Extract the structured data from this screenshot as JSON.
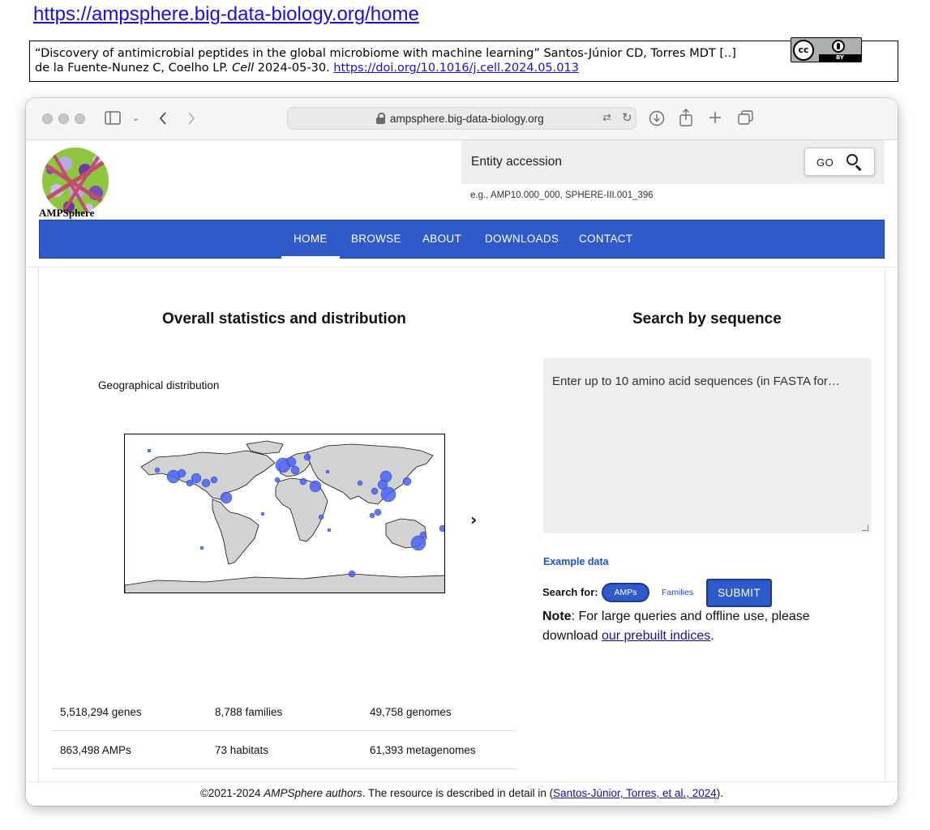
{
  "citation": {
    "top_url": "https://ampsphere.big-data-biology.org/home",
    "line1": "“Discovery of antimicrobial peptides in the global microbiome with machine learning” Santos-Júnior CD, Torres MDT [..]",
    "line2_pre": "de la Fuente-Nunez C, Coelho LP.",
    "journal": "Cell",
    "date": "2024-05-30.",
    "doi": "https://doi.org/10.1016/j.cell.2024.05.013",
    "license_badge": {
      "cc": "cc",
      "by": "BY"
    }
  },
  "browser": {
    "address": "ampsphere.big-data-biology.org"
  },
  "header": {
    "logo_text": "AMPSphere",
    "search": {
      "placeholder": "Entity accession",
      "go_label": "GO",
      "hint": "e.g., AMP10.000_000, SPHERE-III.001_396"
    }
  },
  "nav": {
    "items": [
      "HOME",
      "BROWSE",
      "ABOUT",
      "DOWNLOADS",
      "CONTACT"
    ],
    "active": "HOME"
  },
  "stats": {
    "heading": "Overall statistics and distribution",
    "map_title": "Geographical distribution",
    "rows": [
      [
        "5,518,294 genes",
        "8,788 families",
        "49,758 genomes"
      ],
      [
        "863,498 AMPs",
        "73 habitats",
        "61,393 metagenomes"
      ]
    ]
  },
  "sequence_search": {
    "heading": "Search by sequence",
    "placeholder": "Enter up to 10 amino acid sequences (in FASTA for…",
    "example_link": "Example data",
    "search_for_label": "Search for:",
    "options": [
      "AMPs",
      "Families"
    ],
    "selected": "AMPs",
    "submit_label": "SUBMIT",
    "note_label": "Note",
    "note_text": ": For large queries and offline use, please download ",
    "note_link": "our prebuilt indices",
    "note_end": "."
  },
  "footer": {
    "copyright": "©2021-2024 ",
    "authors": "AMPSphere authors",
    "text": ". The resource is described in detail in (",
    "link": "Santos-Júnior, Torres, et al., 2024",
    "end": ")."
  },
  "colors": {
    "nav_blue": "#2e5bc9",
    "link_blue": "#1a0dec",
    "map_land": "#d3d3d3",
    "map_point": "#4a63f0"
  }
}
